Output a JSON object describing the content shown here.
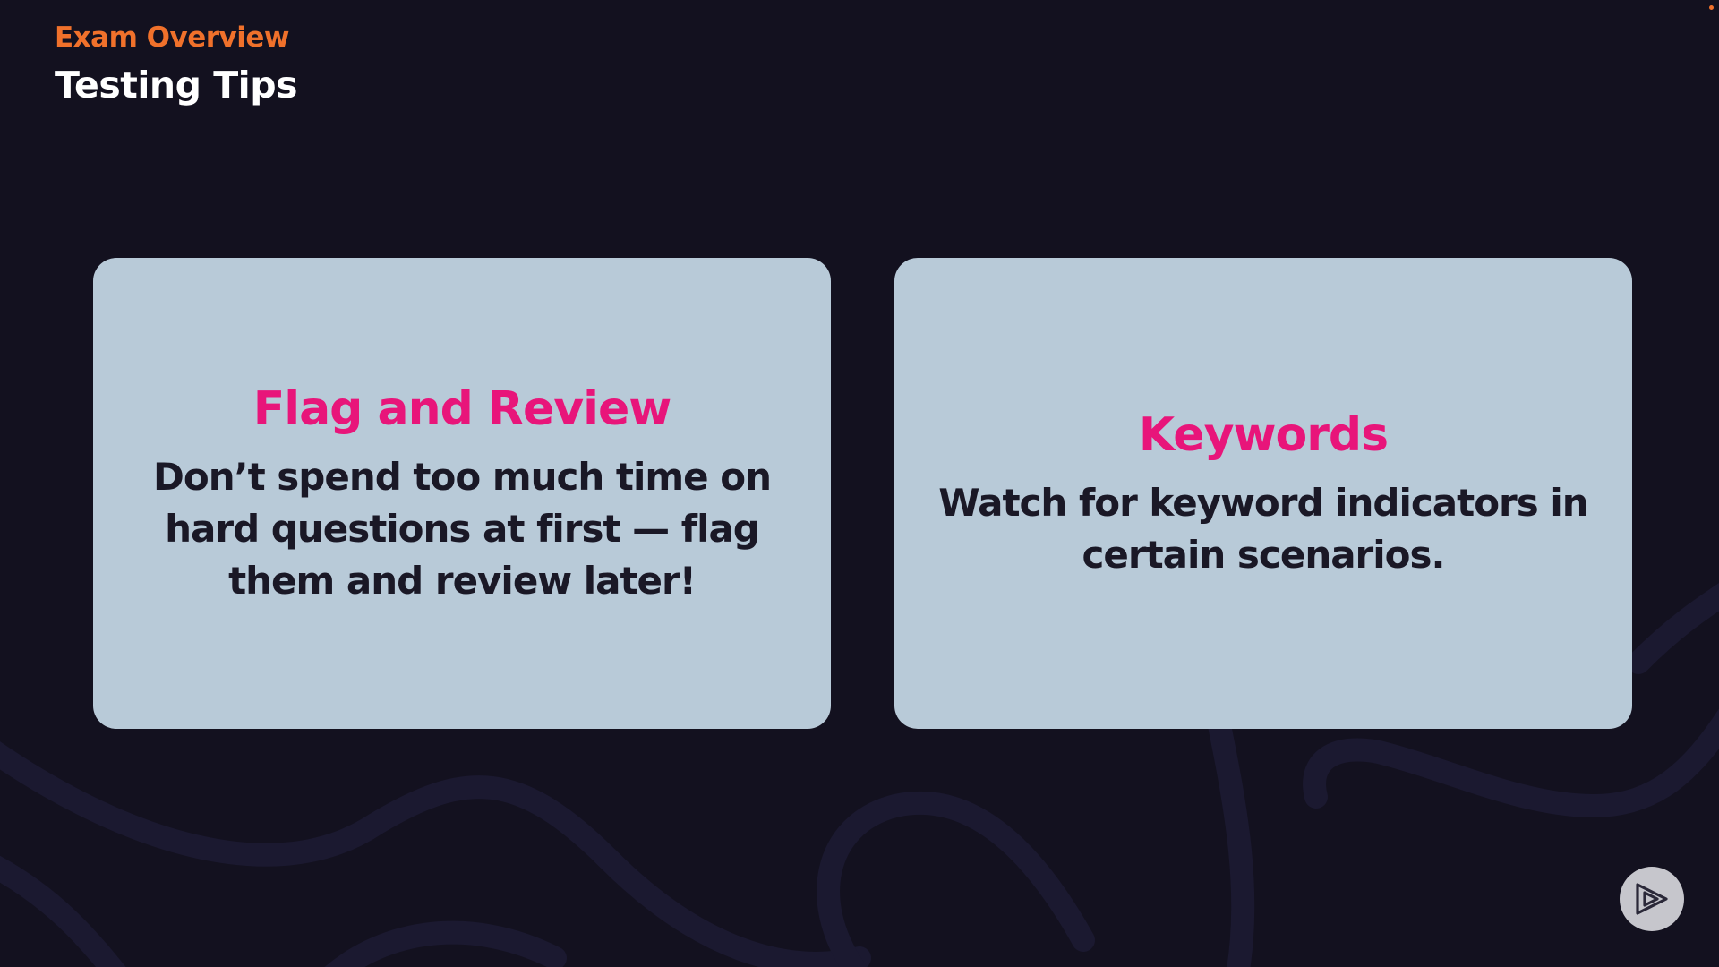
{
  "header": {
    "eyebrow": "Exam Overview",
    "title": "Testing Tips"
  },
  "cards": [
    {
      "heading": "Flag and Review",
      "body": "Don’t spend too much time on hard questions at first — flag them and review later!"
    },
    {
      "heading": "Keywords",
      "body": "Watch for keyword indicators in certain scenarios."
    }
  ],
  "icons": {
    "player": "play-logo-icon"
  },
  "colors": {
    "background": "#13111f",
    "eyebrow": "#f0712b",
    "title": "#ffffff",
    "card_background": "#b8cad8",
    "card_heading": "#e8157a",
    "card_body": "#1a1826"
  }
}
